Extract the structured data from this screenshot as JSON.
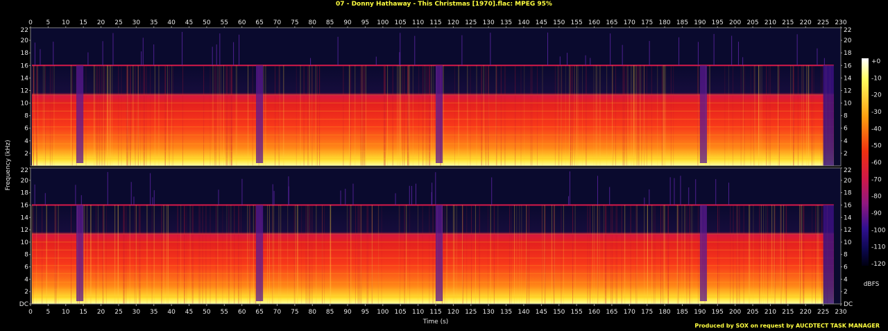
{
  "title": "07 - Donny Hathaway - This Christmas [1970].flac: MPEG 95%",
  "footer": "Produced by SOX on request by AUCDTECT TASK MANAGER",
  "chart_data": {
    "type": "heatmap",
    "title": "07 - Donny Hathaway - This Christmas [1970].flac: MPEG 95%",
    "xlabel": "Time (s)",
    "ylabel": "Frequency (kHz)",
    "xlim": [
      0,
      230
    ],
    "ylim_khz": [
      0,
      22
    ],
    "x_ticks": [
      "0",
      "5",
      "10",
      "15",
      "20",
      "25",
      "30",
      "35",
      "40",
      "45",
      "50",
      "55",
      "60",
      "65",
      "70",
      "75",
      "80",
      "85",
      "90",
      "95",
      "100",
      "105",
      "110",
      "115",
      "120",
      "125",
      "130",
      "135",
      "140",
      "145",
      "150",
      "155",
      "160",
      "165",
      "170",
      "175",
      "180",
      "185",
      "190",
      "195",
      "200",
      "205",
      "210",
      "215",
      "220",
      "225",
      "230"
    ],
    "y_ticks_top": [
      "22",
      "20",
      "18",
      "16",
      "14",
      "12",
      "10",
      "8",
      "6",
      "4",
      "2"
    ],
    "y_ticks_bottom": [
      "22",
      "20",
      "18",
      "16",
      "14",
      "12",
      "10",
      "8",
      "6",
      "4",
      "2",
      "DC"
    ],
    "channels": 2,
    "lowpass_cutoff_khz": 16,
    "content_end_s": 228,
    "quiet_regions_s": [
      [
        13,
        15
      ],
      [
        64,
        66
      ],
      [
        115,
        117
      ],
      [
        190,
        192
      ]
    ],
    "colorbar": {
      "label": "dBFS",
      "ticks": [
        "+0",
        "-10",
        "-20",
        "-30",
        "-40",
        "-50",
        "-60",
        "-70",
        "-80",
        "-90",
        "-100",
        "-110",
        "-120"
      ],
      "range": [
        -120,
        0
      ]
    },
    "colors": {
      "background": "#000000",
      "title_text": "#ffff40",
      "axis_text": "#e8e8e8",
      "floor": "#0a0a2e",
      "cutoff_band": "#d81a4a",
      "energy_high": "#ffe020",
      "energy_mid": "#ff4010"
    }
  }
}
